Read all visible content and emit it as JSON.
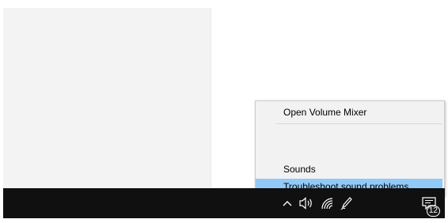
{
  "context_menu": {
    "items": [
      {
        "label": "Open Volume Mixer"
      },
      {
        "label": "Sounds"
      },
      {
        "label": "Troubleshoot sound problems",
        "highlighted": true
      }
    ],
    "highlight_color": "#91c9f7"
  },
  "taskbar": {
    "tray_icons": [
      "chevron-up-icon",
      "speaker-icon",
      "wifi-icon",
      "pen-icon",
      "notification-icon"
    ],
    "notification_count": "12"
  }
}
